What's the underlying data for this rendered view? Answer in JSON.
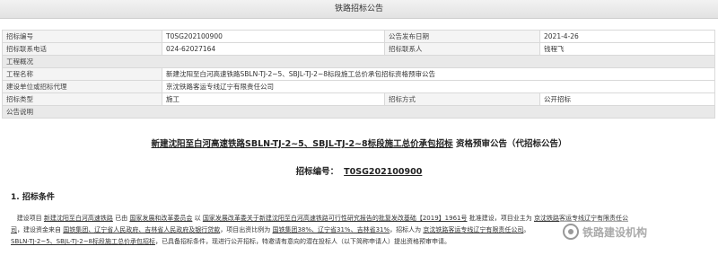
{
  "window": {
    "title": "铁路招标公告"
  },
  "info_table": {
    "bid_no_label": "招标编号",
    "bid_no_value": "T0SG202100900",
    "publish_date_label": "公告发布日期",
    "publish_date_value": "2021-4-26",
    "contact_phone_label": "招标联系电话",
    "contact_phone_value": "024-62027164",
    "contact_person_label": "招标联系人",
    "contact_person_value": "钱程飞",
    "overview_label": "工程概况",
    "project_name_label": "工程名称",
    "project_name_value": "新建沈阳至白河高速铁路SBLN-TJ-2~5、SBJL-TJ-2~8标段施工总价承包招标资格预审公告",
    "unit_label": "建设单位或招标代理",
    "unit_value": "京沈铁路客运专线辽宁有限责任公司",
    "bid_type_label": "招标类型",
    "bid_type_value": "施工",
    "bid_method_label": "招标方式",
    "bid_method_value": "公开招标",
    "notice_label": "公告说明"
  },
  "document": {
    "title": "新建沈阳至白河高速铁路SBLN-TJ-2~5、SBJL-TJ-2~8标段施工总价承包招标",
    "title_suffix": " 资格预审公告（代招标公告）",
    "code_label": "招标编号：",
    "code_value": "T0SG202100900",
    "section1": "1. 招标条件",
    "line1_a": "建设项目",
    "line1_b": "新建沈阳至白河高速铁路",
    "line1_c": "已由",
    "line1_d": "国家发展和改革委员会",
    "line1_e": "以",
    "line1_f": "国家发展改革委关于新建沈阳至白河高速铁路可行性研究报告的批复发改基础【2019】1961号",
    "line1_g": "批准建设，项目业主为",
    "line1_h": "京沈铁路客运专线辽宁有限责任公",
    "line2_a": "司",
    "line2_b": "，建设资金来自",
    "line2_c": "国铁集团、辽宁省人民政府、吉林省人民政府及银行贷款",
    "line2_d": "，项目出资比例为",
    "line2_e": "国铁集团38%、辽宁省31%、吉林省31%",
    "line2_f": "，招标人为",
    "line2_g": "京沈铁路客运专线辽宁有限责任公司",
    "line2_h": "。",
    "line3_a": "SBLN-TJ-2~5、SBJL-TJ-2~8标段施工总价承包招标",
    "line3_b": "，已具备招标条件，现进行公开招标，特邀请有意向的潜在投标人（以下简称申请人）提出资格预审申请。"
  },
  "watermark": {
    "text": "铁路建设机构"
  }
}
